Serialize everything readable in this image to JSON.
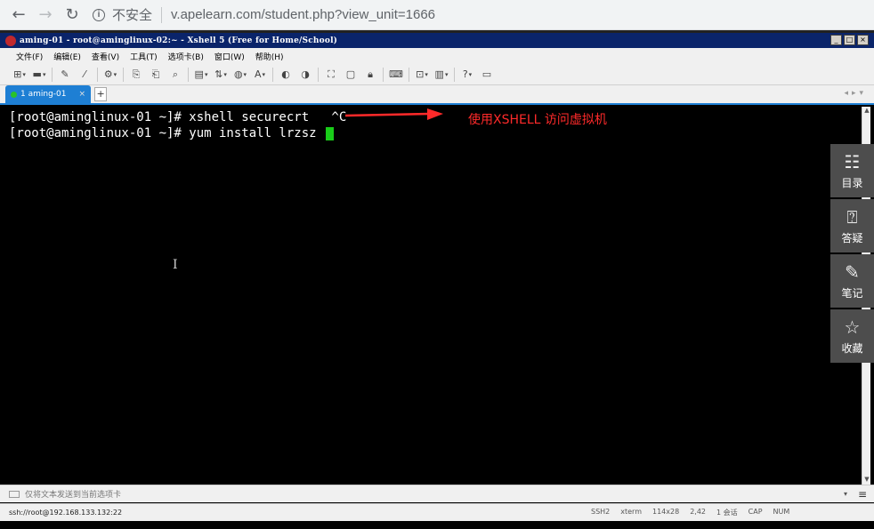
{
  "browser": {
    "back_icon": "arrow-left-icon",
    "forward_icon": "arrow-right-icon",
    "reload_icon": "reload-icon",
    "security_label": "不安全",
    "url": "v.apelearn.com/student.php?view_unit=1666"
  },
  "xshell": {
    "title": "aming-01 - root@aminglinux-02:~ - Xshell 5 (Free for Home/School)",
    "menu": [
      "文件(F)",
      "编辑(E)",
      "查看(V)",
      "工具(T)",
      "选项卡(B)",
      "窗口(W)",
      "帮助(H)"
    ],
    "tab_label": "1 aming-01",
    "terminal_lines": [
      "[root@aminglinux-01 ~]# xshell securecrt   ^C",
      "[root@aminglinux-01 ~]# yum install lrzsz "
    ],
    "annotation": "使用XSHELL 访问虚拟机",
    "input_placeholder": "仅将文本发送到当前选项卡",
    "status_left": "ssh://root@192.168.133.132:22",
    "status_right": [
      "SSH2",
      "xterm",
      "114x28",
      "2,42",
      "1 会话",
      "CAP",
      "NUM"
    ]
  },
  "side_panel": [
    {
      "label": "目录",
      "icon": "catalog-icon"
    },
    {
      "label": "答疑",
      "icon": "question-icon"
    },
    {
      "label": "笔记",
      "icon": "note-edit-icon"
    },
    {
      "label": "收藏",
      "icon": "star-icon"
    }
  ],
  "colors": {
    "accent": "#1e7fd4",
    "annotation": "#ff2a2a",
    "cursor": "#19cc19",
    "panel": "#4d4d4d"
  }
}
